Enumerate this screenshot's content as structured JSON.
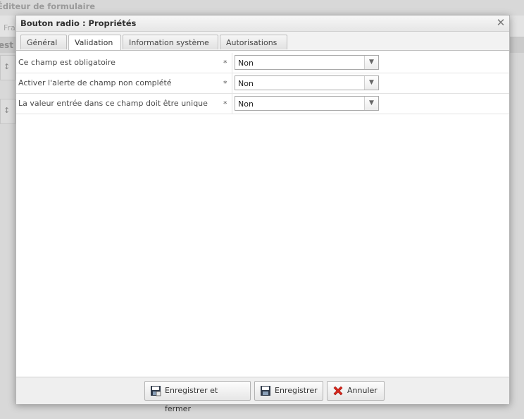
{
  "background": {
    "app_title": "Éditeur de formulaire",
    "tab_text": "Fra",
    "section_text": "est"
  },
  "dialog": {
    "title": "Bouton radio : Propriétés",
    "close_icon": "close-icon"
  },
  "tabs": [
    {
      "label": "Général",
      "active": false
    },
    {
      "label": "Validation",
      "active": true
    },
    {
      "label": "Information système",
      "active": false
    },
    {
      "label": "Autorisations",
      "active": false
    }
  ],
  "fields": [
    {
      "label": "Ce champ est obligatoire",
      "required_mark": "*",
      "value": "Non"
    },
    {
      "label": "Activer l'alerte de champ non complété",
      "required_mark": "*",
      "value": "Non"
    },
    {
      "label": "La valeur entrée dans ce champ doit être unique",
      "required_mark": "*",
      "value": "Non"
    }
  ],
  "footer": {
    "save_close_label": "Enregistrer et fermer",
    "save_label": "Enregistrer",
    "cancel_label": "Annuler",
    "save_close_icon": "save-close-icon",
    "save_icon": "floppy-disk-icon",
    "cancel_icon": "red-x-icon"
  },
  "colors": {
    "cancel_red": "#d9261c",
    "floppy_dark": "#2f3a4a"
  }
}
